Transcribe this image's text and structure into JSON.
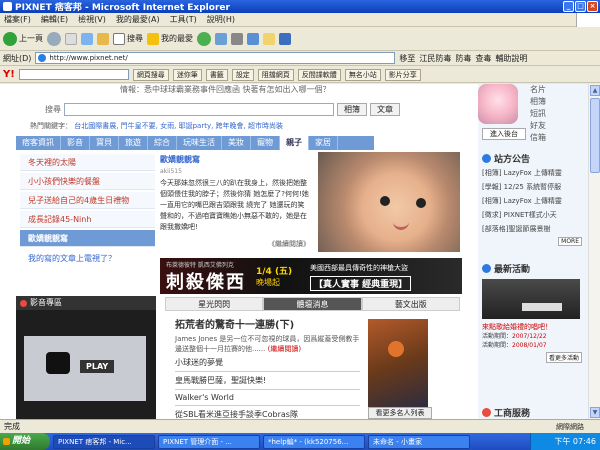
{
  "window": {
    "title": "PIXNET 痞客邦 - Microsoft Internet Explorer"
  },
  "menu": [
    "檔案(F)",
    "編輯(E)",
    "檢視(V)",
    "我的最愛(A)",
    "工具(T)",
    "說明(H)"
  ],
  "toolbar": {
    "back": "上一頁",
    "search": "搜尋",
    "favorites": "我的最愛"
  },
  "address": {
    "label": "網址(D)",
    "url": "http://www.pixnet.net/",
    "go": "移至",
    "tools": [
      "江民防毒",
      "防毒",
      "查毒",
      "輔助說明"
    ]
  },
  "yahoo_bar": {
    "logo": "Y!",
    "buttons": [
      "網頁搜尋",
      "迷你筆",
      "書籤",
      "設定",
      "阻擋網頁",
      "反間諜軟體",
      "無名小站",
      "影片分享"
    ]
  },
  "page": {
    "notice": "情報：悉中球球霸業務事件回應函    快著有怎如出入哪一個？",
    "search": {
      "label": "搜尋",
      "btn1": "相簿",
      "btn2": "文章"
    },
    "hot_label": "熱門關鍵字：",
    "hot_keywords": "台北國際書展, 門牛皇不要, 女雨, 耶誕party, 跨年晚會, 超市時尚裝",
    "nav": [
      "痞客資訊",
      "影音",
      "寶貝",
      "旅遊",
      "綜合",
      "玩味生活",
      "美妝",
      "寵物",
      "親子",
      "家居"
    ],
    "nav_active_index": 8,
    "left_list": [
      "冬天裡的太陽",
      "小小孩們快樂的餐盤",
      "兒子送給自己的4歲生日禮物",
      "成長記錄45-Ninh",
      "歐嬌靚靚寫",
      "我的寫的文章上電視了？"
    ],
    "left_list_highlight_index": 4,
    "post": {
      "title": "歐嬌靚靚寫",
      "meta": "akii515",
      "body": "今天那妹忽然很三八的趴在我身上，然後把她整個頭偎住我的脖子；然後你猜 她怎麼了?何何!她一直用它的嘴巴跟吉頭跟我 繞完了 她還玩的笑聲和的，不過咱寶寶瞧她小無惡不敢的，她是在跟我撒嬌吧!",
      "more": "《繼續閱讀》"
    },
    "ad": {
      "top": "布萊德彼特 凱西艾佛列克",
      "big": "刺殺傑西",
      "date": "1/4 (五)",
      "date2": "晚場起",
      "cap": "美國西部最具傳奇性的神槍大盜",
      "cap2": "【真人實事 經典重現】"
    },
    "video": {
      "header": "影音專區",
      "play": "PLAY"
    },
    "mid_tabs": [
      "星光閃閃",
      "體壇消息",
      "藝文出版"
    ],
    "mid_tab_active": 1,
    "news": {
      "title": "拓荒者的驚奇十一連勝(下)",
      "body": "James Jones 是另一位不可忽視的球員，因爲縱蓋受側教手邊送整個十一月拉賽的他......",
      "more": "(繼續閱讀)",
      "items": [
        "小球迷的夢覺",
        "皇馬戰勝巴薩，聖誕快樂!",
        "Walker's World",
        "從SBL看米進亞接手談季Cobras隊"
      ]
    },
    "photo_btn": "看更多名人列表"
  },
  "right": {
    "links": [
      "名片",
      "相簿",
      "短訊",
      "好友",
      "信箱"
    ],
    "backend": "進入後台",
    "announce_title": "站方公告",
    "announcements": [
      "[相簿] LazyFox 上傳精靈",
      "[學報] 12/25 系統暫停服",
      "[相簿] LazyFox 上傳精靈",
      "[徵求] PIXNET樣式小天",
      "[部落格]聖誕節展景樹"
    ],
    "more": "MORE",
    "events_title": "最新活動",
    "event_name": "來點歌給婚禮的唱吧！",
    "event_date1": "2007/12/22",
    "event_date2": "2008/01/07",
    "event_date_label1": "活動期間：",
    "event_date_label2": "活動期間：",
    "events_more": "看更多活動",
    "jobs_title": "工商服務"
  },
  "status": {
    "text": "完成",
    "zone": "網際網路"
  },
  "taskbar": {
    "start": "開始",
    "tasks": [
      "PIXNET 痞客邦 - Mic...",
      "PIXNET 管理介面 - ...",
      "*help編* - (kk520756...",
      "未命名 - 小畫家"
    ],
    "active_index": 0,
    "clock": "下午 07:46"
  },
  "colors": {
    "nav_blue": "#6e9ad6",
    "link_red": "#c0392b",
    "xp_blue": "#0b3fb8"
  }
}
